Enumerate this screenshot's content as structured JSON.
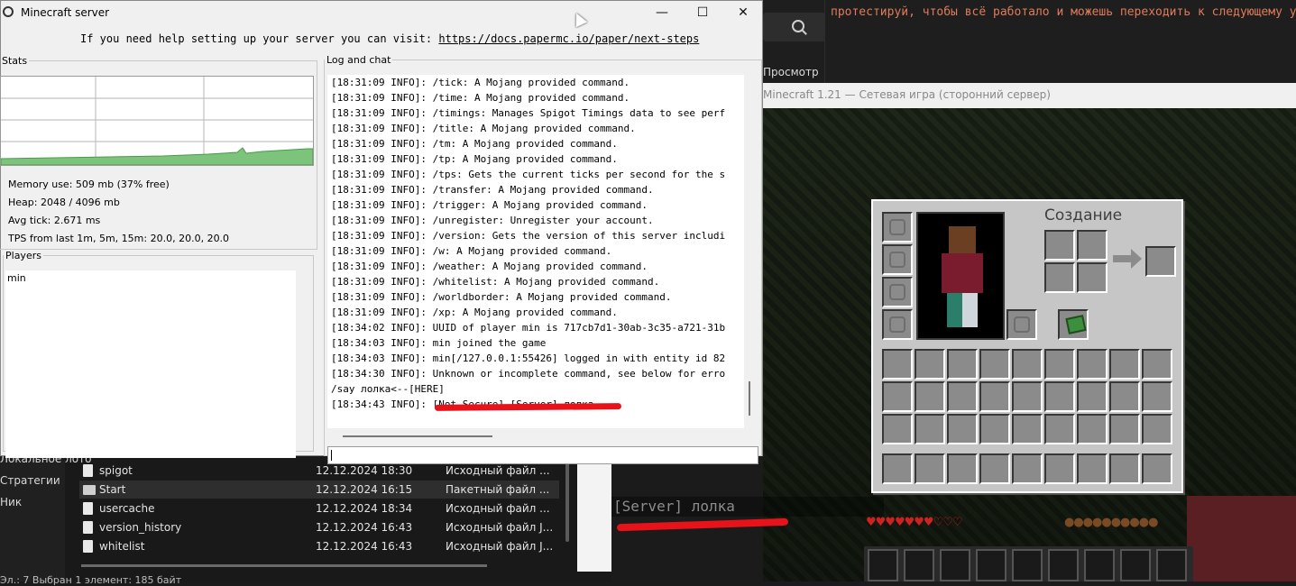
{
  "editor": {
    "line": "протестируй, чтобы всё работало и можешь переходить к следующему уроку",
    "preview_tab": "Просмотр"
  },
  "game": {
    "window_title": "Minecraft 1.21 — Сетевая игра (сторонний сервер)",
    "crafting_title": "Создание",
    "chat_message": "[Server] лолка"
  },
  "explorer": {
    "nav": [
      "Локальное лото",
      "Стратегии",
      "Ник"
    ],
    "files": [
      {
        "name": "spigot",
        "date": "12.12.2024 18:30",
        "type": "Исходный файл ...",
        "selected": false,
        "kind": "doc"
      },
      {
        "name": "Start",
        "date": "12.12.2024 16:15",
        "type": "Пакетный файл ...",
        "selected": true,
        "kind": "bat"
      },
      {
        "name": "usercache",
        "date": "12.12.2024 18:34",
        "type": "Исходный файл ...",
        "selected": false,
        "kind": "doc"
      },
      {
        "name": "version_history",
        "date": "12.12.2024 16:43",
        "type": "Исходный файл J...",
        "selected": false,
        "kind": "doc"
      },
      {
        "name": "whitelist",
        "date": "12.12.2024 16:43",
        "type": "Исходный файл J...",
        "selected": false,
        "kind": "doc"
      }
    ],
    "status": "Эл.: 7  Выбран 1 элемент: 185 байт"
  },
  "server": {
    "title": "Minecraft server",
    "controls": {
      "minimize": "—",
      "maximize": "☐",
      "close": "✕"
    },
    "help_text": "If you need help setting up your server you can visit:",
    "help_link": "https://docs.papermc.io/paper/next-steps",
    "stats_legend": "Stats",
    "stats": {
      "memory": "Memory use: 509 mb (37% free)",
      "heap": "Heap: 2048 / 4096 mb",
      "tick": "Avg tick: 2.671 ms",
      "tps": "TPS from last 1m, 5m, 15m: 20.0, 20.0, 20.0"
    },
    "players_legend": "Players",
    "players": [
      "min"
    ],
    "log_legend": "Log and chat",
    "log": [
      "[18:31:09 INFO]: /tick: A Mojang provided command.",
      "[18:31:09 INFO]: /time: A Mojang provided command.",
      "[18:31:09 INFO]: /timings: Manages Spigot Timings data to see perf",
      "[18:31:09 INFO]: /title: A Mojang provided command.",
      "[18:31:09 INFO]: /tm: A Mojang provided command.",
      "[18:31:09 INFO]: /tp: A Mojang provided command.",
      "[18:31:09 INFO]: /tps: Gets the current ticks per second for the s",
      "[18:31:09 INFO]: /transfer: A Mojang provided command.",
      "[18:31:09 INFO]: /trigger: A Mojang provided command.",
      "[18:31:09 INFO]: /unregister: Unregister your account.",
      "[18:31:09 INFO]: /version: Gets the version of this server includi",
      "[18:31:09 INFO]: /w: A Mojang provided command.",
      "[18:31:09 INFO]: /weather: A Mojang provided command.",
      "[18:31:09 INFO]: /whitelist: A Mojang provided command.",
      "[18:31:09 INFO]: /worldborder: A Mojang provided command.",
      "[18:31:09 INFO]: /xp: A Mojang provided command.",
      "[18:34:02 INFO]: UUID of player min is 717cb7d1-30ab-3c35-a721-31b",
      "[18:34:03 INFO]: min joined the game",
      "[18:34:03 INFO]: min[/127.0.0.1:55426] logged in with entity id 82",
      "[18:34:30 INFO]: Unknown or incomplete command, see below for erro",
      "/say лолка<--[HERE]",
      "[18:34:43 INFO]: [Not Secure] [Server] лолка"
    ],
    "command_input": ""
  },
  "colors": {
    "annotation": "#e8121b",
    "graph_fill": "#7cc47c",
    "editor_text": "#e07b5a"
  }
}
